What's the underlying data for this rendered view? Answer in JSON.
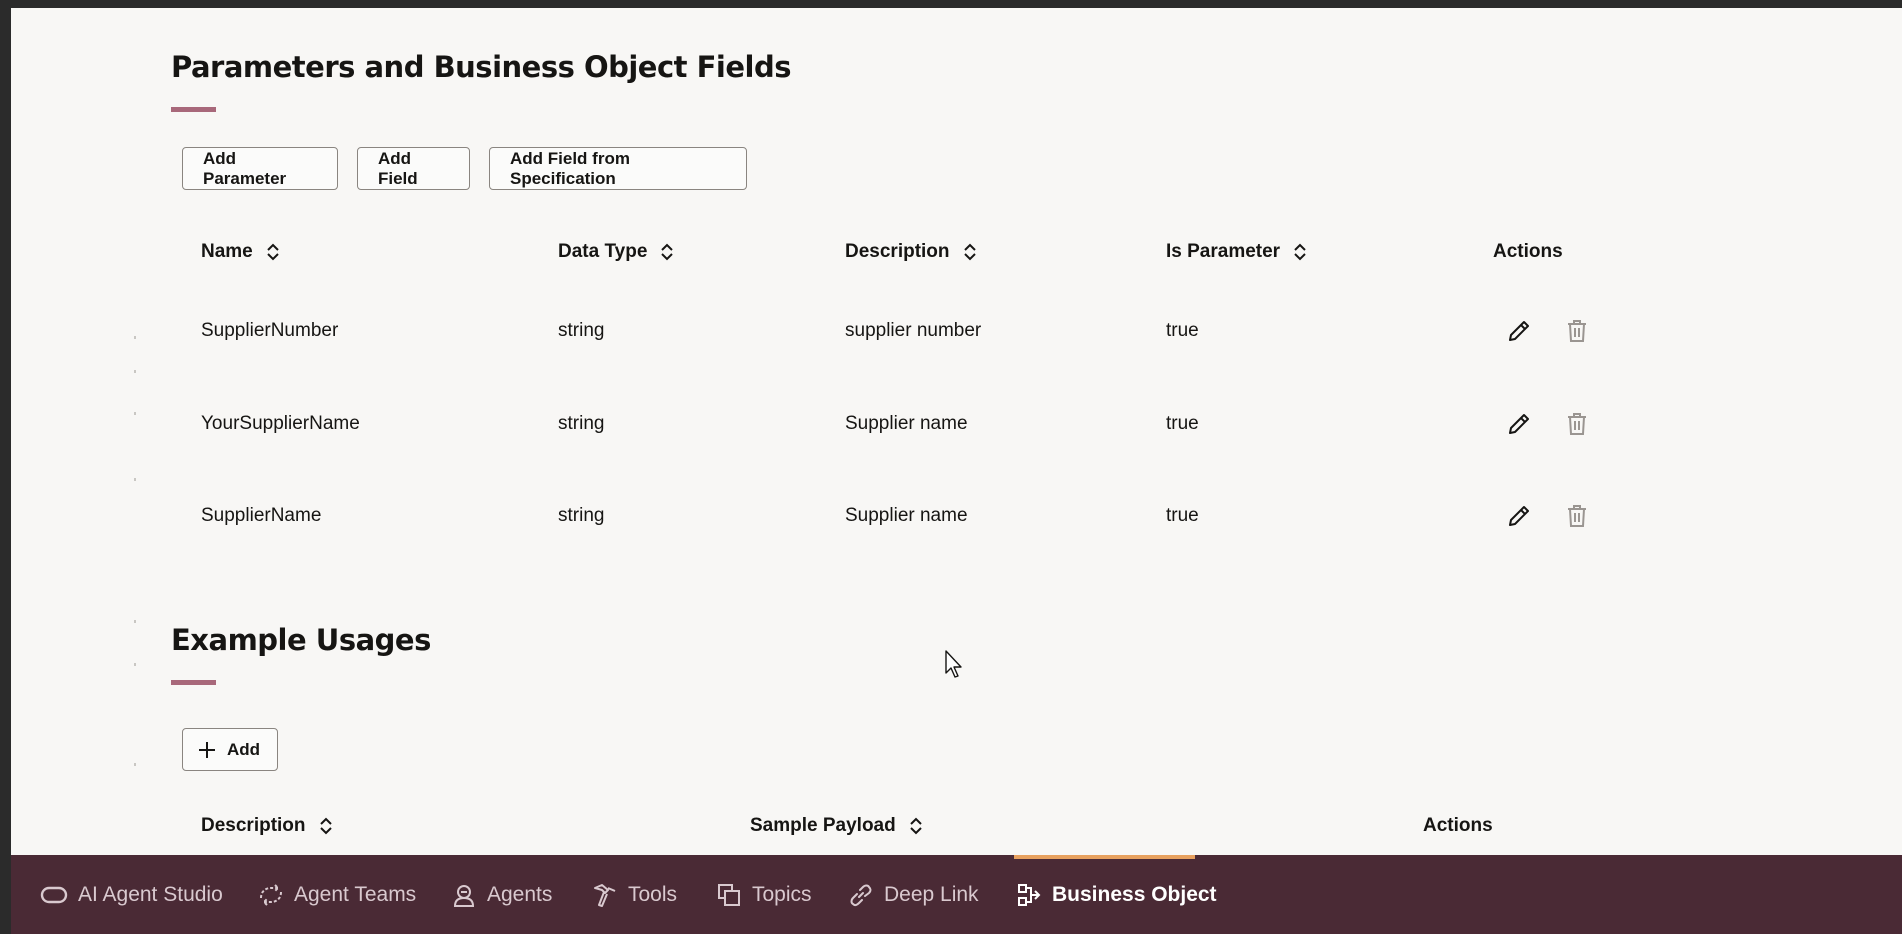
{
  "sections": {
    "params": {
      "title": "Parameters and Business Object Fields",
      "buttons": {
        "add_parameter": "Add Parameter",
        "add_field": "Add Field",
        "add_field_from_spec": "Add Field from Specification"
      },
      "columns": [
        "Name",
        "Data Type",
        "Description",
        "Is Parameter",
        "Actions"
      ],
      "rows": [
        {
          "name": "SupplierNumber",
          "data_type": "string",
          "description": "supplier number",
          "is_parameter": "true"
        },
        {
          "name": "YourSupplierName",
          "data_type": "string",
          "description": "Supplier name",
          "is_parameter": "true"
        },
        {
          "name": "SupplierName",
          "data_type": "string",
          "description": "Supplier name",
          "is_parameter": "true"
        }
      ]
    },
    "examples": {
      "title": "Example Usages",
      "add_label": "Add",
      "columns": [
        "Description",
        "Sample Payload",
        "Actions"
      ]
    }
  },
  "bottom_nav": {
    "items": [
      {
        "label": "AI Agent Studio",
        "icon": "pill-icon"
      },
      {
        "label": "Agent Teams",
        "icon": "team-link-icon"
      },
      {
        "label": "Agents",
        "icon": "agent-icon"
      },
      {
        "label": "Tools",
        "icon": "hammer-icon"
      },
      {
        "label": "Topics",
        "icon": "stacked-squares-icon"
      },
      {
        "label": "Deep Link",
        "icon": "link-icon"
      },
      {
        "label": "Business Object",
        "icon": "business-object-icon"
      }
    ],
    "active": "Business Object"
  },
  "colors": {
    "accent_bar": "#a8687a",
    "nav_background": "#4a2a35",
    "nav_active_indicator": "#e8a15f",
    "page_background": "#f8f7f5"
  }
}
